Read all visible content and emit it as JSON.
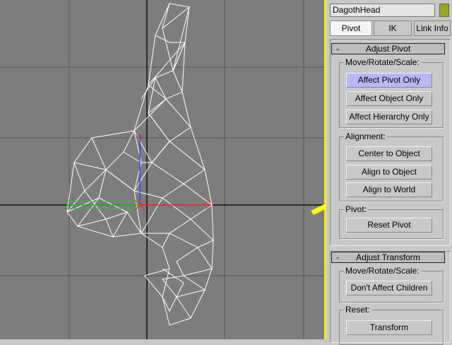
{
  "object_name": "DagothHead",
  "colors": {
    "object_color": "#9aa61a",
    "viewport_border": "#f0f000",
    "arrow": "#ffff00",
    "active_button": "#b8b8f8"
  },
  "tabs": [
    {
      "label": "Pivot",
      "active": true
    },
    {
      "label": "IK"
    },
    {
      "label": "Link Info"
    }
  ],
  "adjust_pivot": {
    "title": "Adjust Pivot",
    "collapse": "-",
    "move_group": "Move/Rotate/Scale:",
    "move_buttons": [
      "Affect Pivot Only",
      "Affect Object Only",
      "Affect Hierarchy Only"
    ],
    "alignment_group": "Alignment:",
    "alignment_buttons": [
      "Center to Object",
      "Align to Object",
      "Align to World"
    ],
    "pivot_group": "Pivot:",
    "reset_pivot": "Reset Pivot"
  },
  "adjust_transform": {
    "title": "Adjust Transform",
    "collapse": "-",
    "move_group": "Move/Rotate/Scale:",
    "dont_affect": "Don't Affect Children",
    "reset_group": "Reset:",
    "transform": "Transform"
  }
}
